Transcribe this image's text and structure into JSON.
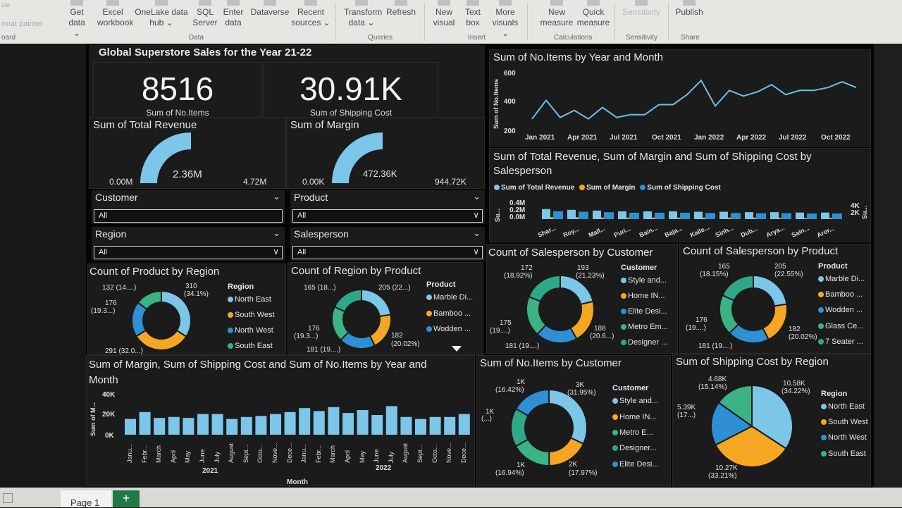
{
  "ribbon": {
    "items": [
      {
        "l1": "Get",
        "l2": "data ⌄"
      },
      {
        "l1": "Excel",
        "l2": "workbook"
      },
      {
        "l1": "OneLake data",
        "l2": "hub ⌄"
      },
      {
        "l1": "SQL",
        "l2": "Server"
      },
      {
        "l1": "Enter",
        "l2": "data"
      },
      {
        "l1": "Dataverse",
        "l2": ""
      },
      {
        "l1": "Recent",
        "l2": "sources ⌄"
      },
      {
        "l1": "Transform",
        "l2": "data ⌄"
      },
      {
        "l1": "Refresh",
        "l2": ""
      },
      {
        "l1": "New",
        "l2": "visual"
      },
      {
        "l1": "Text",
        "l2": "box"
      },
      {
        "l1": "More",
        "l2": "visuals ⌄"
      },
      {
        "l1": "New",
        "l2": "measure"
      },
      {
        "l1": "Quick",
        "l2": "measure"
      },
      {
        "l1": "Sensitivity",
        "l2": ""
      },
      {
        "l1": "Publish",
        "l2": ""
      }
    ],
    "groups": [
      "oard",
      "Data",
      "Queries",
      "Insert",
      "Calculations",
      "Sensitivity",
      "Share"
    ],
    "left_faded": [
      "ste",
      "rmat painter"
    ]
  },
  "status": {
    "page": "Page 1",
    "add": "+"
  },
  "dashboard": {
    "title": "Global Superstore Sales for the Year 21-22"
  },
  "cards": [
    {
      "value": "8516",
      "label": "Sum of No.Items"
    },
    {
      "value": "30.91K",
      "label": "Sum of Shipping Cost"
    }
  ],
  "gauges": [
    {
      "title": "Sum of Total Revenue",
      "min": "0.00M",
      "value": "2.36M",
      "max": "4.72M",
      "fraction": 0.5
    },
    {
      "title": "Sum of Margin",
      "min": "0.00K",
      "value": "472.36K",
      "max": "944.72K",
      "fraction": 0.5
    }
  ],
  "slicers": [
    {
      "label": "Customer",
      "value": "All"
    },
    {
      "label": "Product",
      "value": "All"
    },
    {
      "label": "Region",
      "value": "All"
    },
    {
      "label": "Salesperson",
      "value": "All"
    }
  ],
  "line_chart": {
    "title": "Sum of No.Items by Year and Month",
    "ylabel": "Sum of No.Items",
    "yticks": [
      "600",
      "400",
      "200"
    ],
    "xticks": [
      "Jan 2021",
      "Apr 2021",
      "Jul 2021",
      "Oct 2021",
      "Jan 2022",
      "Apr 2022",
      "Jul 2022",
      "Oct 2022"
    ]
  },
  "cluster": {
    "title1": "Sum of Total Revenue, Sum of Margin and Sum of Shipping Cost by",
    "title2": "Salesperson",
    "legend": [
      "Sum of Total Revenue",
      "Sum of Margin",
      "Sum of Shipping Cost"
    ],
    "yleft": [
      "0.4M",
      "0.2M",
      "0.0M"
    ],
    "yright": [
      "4K",
      "2K"
    ],
    "ylabel": "Su...",
    "ylabel_r": "Su...",
    "xticks": [
      "Shar...",
      "Roy...",
      "Mall...",
      "Puri...",
      "Bain...",
      "Baja...",
      "Kalle...",
      "Sinh...",
      "Dub...",
      "Arya...",
      "Sain...",
      "Aror..."
    ]
  },
  "donut_region": {
    "title": "Count of Product by Region",
    "legend_title": "Region",
    "legend": [
      "North East",
      "South West",
      "North West",
      "South East"
    ],
    "labels": [
      "132 (14....)",
      "310",
      "(34.1%)",
      "176",
      "(19.3...)",
      "291 (32.0...)"
    ]
  },
  "donut_product": {
    "title": "Count of Region by Product",
    "legend_title": "Product",
    "legend": [
      "Marble Di...",
      "Bamboo ...",
      "Wodden ..."
    ],
    "labels": [
      "165 (18...)",
      "205 (22...)",
      "176",
      "(19.3...)",
      "182",
      "(20.02%)",
      "181 (19....)"
    ]
  },
  "donut_sp_customer": {
    "title": "Count of Salesperson by Customer",
    "legend_title": "Customer",
    "legend": [
      "Style and...",
      "Home IN...",
      "Elite Desi...",
      "Metro Em...",
      "Designer ..."
    ],
    "labels": [
      "172",
      "(18.92%)",
      "193",
      "(21.23%)",
      "175",
      "(19....)",
      "188",
      "(20.6...)",
      "181 (19....)"
    ]
  },
  "donut_sp_product": {
    "title": "Count of Salesperson by Product",
    "legend_title": "Product",
    "legend": [
      "Marble Di...",
      "Bamboo ...",
      "Wodden ...",
      "Glass Ce...",
      "7 Seater ..."
    ],
    "labels": [
      "165",
      "(18.15%)",
      "205",
      "(22.55%)",
      "176",
      "(19....)",
      "182",
      "(20.02%)",
      "181 (19....)"
    ]
  },
  "bar_chart": {
    "title1": "Sum of Margin, Sum of Shipping Cost and Sum of No.Items by Year and",
    "title2": "Month",
    "yticks": [
      "40K",
      "20K",
      "0K"
    ],
    "ylabel": "Sum of M...",
    "xlabel": "Month",
    "years": [
      "2021",
      "2022"
    ],
    "months": [
      "Janu...",
      "Febr...",
      "March",
      "April",
      "May",
      "June",
      "July",
      "August",
      "Sept...",
      "Octo...",
      "Nove...",
      "Dece...",
      "Janu...",
      "Febr...",
      "March",
      "April",
      "May",
      "June",
      "July",
      "August",
      "Sept...",
      "Octo...",
      "Nove...",
      "Dece..."
    ]
  },
  "donut_items": {
    "title": "Sum of No.Items by Customer",
    "legend_title": "Customer",
    "legend": [
      "Style and...",
      "Home IN...",
      "Metro E...",
      "Designer...",
      "Elite Desi..."
    ],
    "labels": [
      "1K",
      "(16.42%)",
      "3K",
      "(31.95%)",
      "1K",
      "(...)",
      "1K",
      "(16.94%)",
      "2K",
      "(17.97%)"
    ]
  },
  "pie_ship": {
    "title": "Sum of Shipping Cost by Region",
    "legend_title": "Region",
    "legend": [
      "North East",
      "South West",
      "North West",
      "South East"
    ],
    "labels": [
      "4.68K",
      "(15.14%)",
      "10.58K",
      "(34.22%)",
      "5.39K",
      "(17...)",
      "10.27K",
      "(33.21%)"
    ]
  },
  "colors": {
    "blue": "#7cc6ea",
    "orange": "#f5a623",
    "dblue": "#2e8fd4",
    "teal": "#3bb384",
    "bg": "#1b1b1c"
  },
  "chart_data": [
    {
      "type": "line",
      "title": "Sum of No.Items by Year and Month",
      "ylabel": "Sum of No.Items",
      "ylim": [
        200,
        600
      ],
      "x": [
        "Jan 2021",
        "Feb 2021",
        "Mar 2021",
        "Apr 2021",
        "May 2021",
        "Jun 2021",
        "Jul 2021",
        "Aug 2021",
        "Sep 2021",
        "Oct 2021",
        "Nov 2021",
        "Dec 2021",
        "Jan 2022",
        "Feb 2022",
        "Mar 2022",
        "Apr 2022",
        "May 2022",
        "Jun 2022",
        "Jul 2022",
        "Aug 2022",
        "Sep 2022",
        "Oct 2022",
        "Nov 2022",
        "Dec 2022"
      ],
      "values": [
        300,
        430,
        310,
        360,
        300,
        380,
        310,
        330,
        330,
        400,
        400,
        470,
        570,
        390,
        500,
        460,
        490,
        540,
        470,
        500,
        500,
        520,
        560,
        520
      ]
    },
    {
      "type": "bar",
      "title": "Sum of Total Revenue, Sum of Margin and Sum of Shipping Cost by Salesperson",
      "categories": [
        "Shar...",
        "Roy...",
        "Mall...",
        "Puri...",
        "Bain...",
        "Baja...",
        "Kalle...",
        "Sinh...",
        "Dub...",
        "Arya...",
        "Sain...",
        "Aror..."
      ],
      "series": [
        {
          "name": "Sum of Total Revenue",
          "values": [
            0.26,
            0.24,
            0.22,
            0.2,
            0.2,
            0.2,
            0.19,
            0.19,
            0.18,
            0.18,
            0.17,
            0.17
          ]
        },
        {
          "name": "Sum of Margin",
          "values": [
            0.05,
            0.05,
            0.04,
            0.04,
            0.04,
            0.04,
            0.04,
            0.04,
            0.04,
            0.03,
            0.03,
            0.03
          ]
        },
        {
          "name": "Sum of Shipping Cost",
          "values": [
            3.2,
            3.0,
            2.8,
            2.6,
            2.6,
            2.6,
            2.5,
            2.5,
            2.4,
            2.4,
            2.3,
            2.3
          ]
        }
      ]
    },
    {
      "type": "pie",
      "title": "Count of Product by Region",
      "categories": [
        "North East",
        "South West",
        "North West",
        "South East"
      ],
      "values": [
        132,
        291,
        176,
        310
      ]
    },
    {
      "type": "pie",
      "title": "Count of Region by Product",
      "categories": [
        "Marble Di...",
        "Bamboo ...",
        "Wodden ...",
        "Glass Ce...",
        "7 Seater ..."
      ],
      "values": [
        205,
        182,
        181,
        176,
        165
      ]
    },
    {
      "type": "pie",
      "title": "Count of Salesperson by Customer",
      "categories": [
        "Style and...",
        "Home IN...",
        "Elite Desi...",
        "Metro Em...",
        "Designer ..."
      ],
      "values": [
        193,
        188,
        181,
        175,
        172
      ]
    },
    {
      "type": "pie",
      "title": "Count of Salesperson by Product",
      "categories": [
        "Marble Di...",
        "Bamboo ...",
        "Wodden ...",
        "Glass Ce...",
        "7 Seater ..."
      ],
      "values": [
        205,
        182,
        181,
        176,
        165
      ]
    },
    {
      "type": "bar",
      "title": "Sum of Margin, Sum of Shipping Cost and Sum of No.Items by Year and Month",
      "ylim": [
        0,
        40000
      ],
      "xlabel": "Month",
      "ylabel": "Sum of M...",
      "categories": [
        "Janu...",
        "Febr...",
        "March",
        "April",
        "May",
        "June",
        "July",
        "August",
        "Sept...",
        "Octo...",
        "Nove...",
        "Dece...",
        "Janu...",
        "Febr...",
        "March",
        "April",
        "May",
        "June",
        "July",
        "August",
        "Sept...",
        "Octo...",
        "Nove...",
        "Dece..."
      ],
      "values": [
        16000,
        23000,
        17000,
        18000,
        17000,
        21000,
        21000,
        16000,
        18000,
        19000,
        21000,
        23000,
        27000,
        24000,
        28000,
        22000,
        25000,
        20000,
        29000,
        18000,
        16000,
        18000,
        18000,
        21000,
        21000
      ]
    },
    {
      "type": "pie",
      "title": "Sum of No.Items by Customer",
      "categories": [
        "Style and...",
        "Home IN...",
        "Metro E...",
        "Designer...",
        "Elite Desi..."
      ],
      "values": [
        31.95,
        17.97,
        16.94,
        16.42,
        16.72
      ]
    },
    {
      "type": "pie",
      "title": "Sum of Shipping Cost by Region",
      "categories": [
        "North East",
        "South West",
        "North West",
        "South East"
      ],
      "values": [
        10.58,
        10.27,
        5.39,
        4.68
      ]
    }
  ]
}
